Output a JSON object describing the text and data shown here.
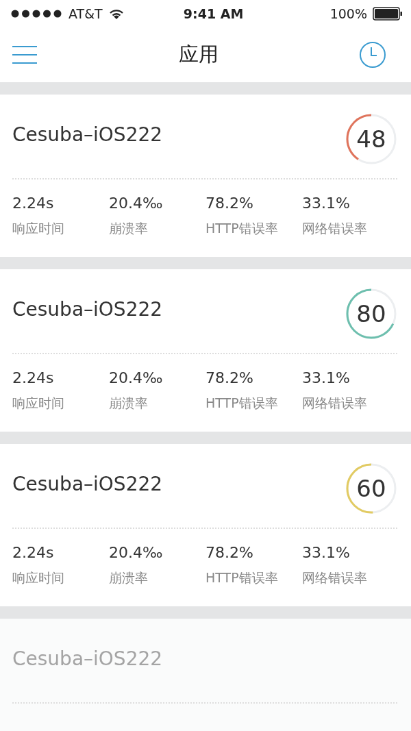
{
  "status_bar": {
    "carrier": "AT&T",
    "time": "9:41 AM",
    "battery": "100%"
  },
  "nav": {
    "title": "应用"
  },
  "apps": [
    {
      "name": "Cesuba–iOS222",
      "score": "48",
      "color": "#e0745c",
      "faded": false,
      "metrics": [
        {
          "value": "2.24s",
          "label": "响应时间"
        },
        {
          "value": "20.4‰",
          "label": "崩溃率"
        },
        {
          "value": "78.2%",
          "label": "HTTP错误率"
        },
        {
          "value": "33.1%",
          "label": "网络错误率"
        }
      ]
    },
    {
      "name": "Cesuba–iOS222",
      "score": "80",
      "color": "#6dbfae",
      "faded": false,
      "metrics": [
        {
          "value": "2.24s",
          "label": "响应时间"
        },
        {
          "value": "20.4‰",
          "label": "崩溃率"
        },
        {
          "value": "78.2%",
          "label": "HTTP错误率"
        },
        {
          "value": "33.1%",
          "label": "网络错误率"
        }
      ]
    },
    {
      "name": "Cesuba–iOS222",
      "score": "60",
      "color": "#e2cb62",
      "faded": false,
      "metrics": [
        {
          "value": "2.24s",
          "label": "响应时间"
        },
        {
          "value": "20.4‰",
          "label": "崩溃率"
        },
        {
          "value": "78.2%",
          "label": "HTTP错误率"
        },
        {
          "value": "33.1%",
          "label": "网络错误率"
        }
      ]
    },
    {
      "name": "Cesuba–iOS222",
      "faded": true
    }
  ]
}
